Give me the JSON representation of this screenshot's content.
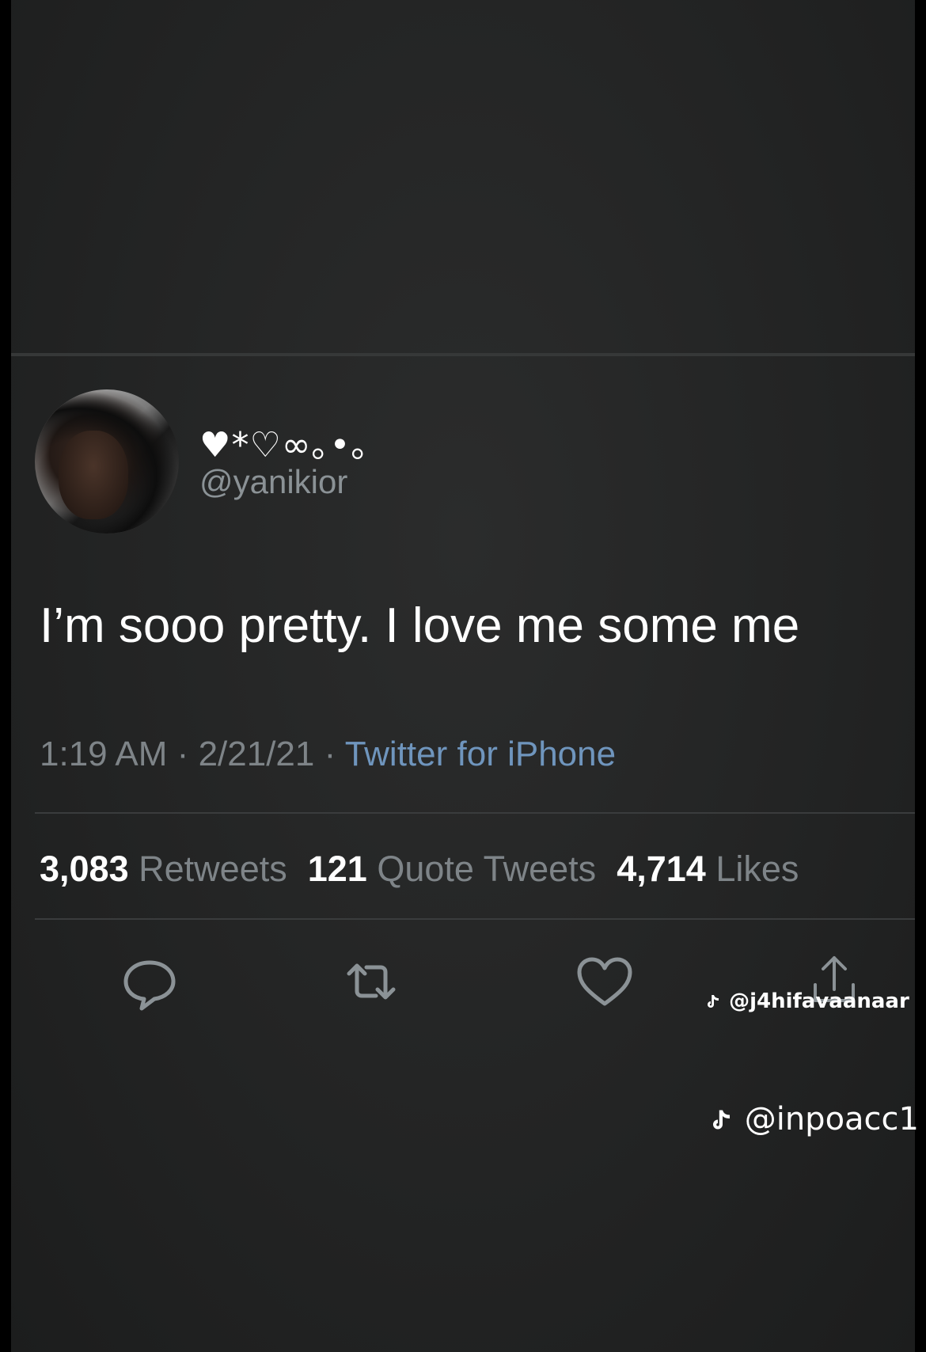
{
  "tweet": {
    "display_name": "♥*♡∞｡•｡",
    "handle": "@yanikior",
    "text": "I’m sooo pretty. I love me some me",
    "time": "1:19 AM",
    "date": "2/21/21",
    "source": "Twitter for iPhone",
    "stats": {
      "retweets_count": "3,083",
      "retweets_label": "Retweets",
      "quotes_count": "121",
      "quotes_label": "Quote Tweets",
      "likes_count": "4,714",
      "likes_label": "Likes"
    },
    "actions": [
      "reply-icon",
      "retweet-icon",
      "like-icon",
      "share-icon"
    ]
  },
  "watermarks": {
    "primary": "@j4hifavaanaar",
    "secondary": "@inpoacc1"
  },
  "colors": {
    "background": "#232424",
    "text": "#ffffff",
    "muted": "#7e8488",
    "link": "#6f95bd",
    "divider": "#3a3c3d"
  }
}
